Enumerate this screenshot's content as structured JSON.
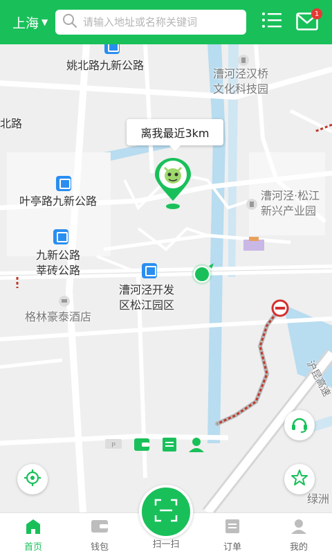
{
  "header": {
    "city": "上海",
    "search_placeholder": "请输入地址或名称关键词",
    "message_badge": "1"
  },
  "map": {
    "labels": {
      "yaobei": "姚北路九新公路",
      "caohejing_hanqiao_1": "漕河泾汉桥",
      "caohejing_hanqiao_2": "文化科技园",
      "beilu": "北路",
      "yeting": "叶亭路九新公路",
      "songjiang_1": "漕河泾·松江",
      "songjiang_2": "新兴产业园",
      "jiuxin_1": "九新公路",
      "jiuxin_2": "莘砖公路",
      "kaifa_1": "漕河泾开发",
      "kaifa_2": "区松江园区",
      "hotel": "格林豪泰酒店",
      "lvzhou": "绿洲",
      "expressway": "沪昆高速"
    },
    "distance_bubble": "离我最近3km"
  },
  "tabs": [
    {
      "label": "首页",
      "icon": "home-icon",
      "active": true
    },
    {
      "label": "钱包",
      "icon": "wallet-icon",
      "active": false
    },
    {
      "label": "扫一扫",
      "icon": "scan-icon",
      "active": false
    },
    {
      "label": "订单",
      "icon": "order-icon",
      "active": false
    },
    {
      "label": "我的",
      "icon": "user-icon",
      "active": false
    }
  ],
  "colors": {
    "brand_green": "#19c05a",
    "bus_blue": "#2a8ef0",
    "alert_red": "#d32f2f"
  }
}
